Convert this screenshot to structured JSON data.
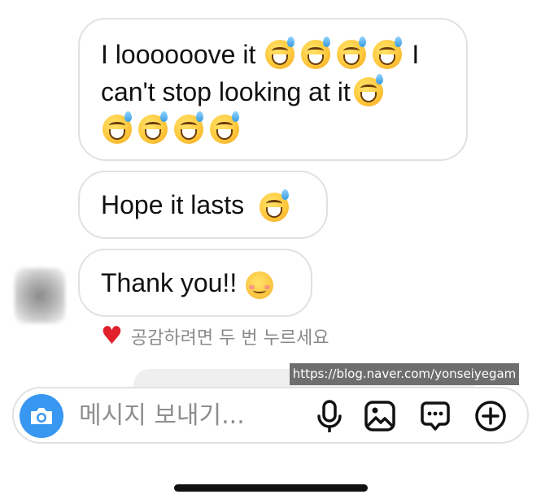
{
  "messages": [
    {
      "lines": [
        {
          "text": "I loooooove it",
          "emoji_after": 4,
          "tail": "I"
        },
        {
          "text": "can't stop looking at it",
          "emoji_after": 1
        },
        {
          "text": "",
          "emoji_after": 4
        }
      ]
    },
    {
      "text": "Hope it lasts",
      "emoji": "grinning-sweat"
    },
    {
      "text": "Thank you!!",
      "emoji": "smiling-blush"
    }
  ],
  "reaction_hint": "공감하려면 두 번 누르세요",
  "watermark": "https://blog.naver.com/yonseiyegam",
  "composer": {
    "placeholder": "메시지 보내기..."
  },
  "icons": [
    "camera-icon",
    "microphone-icon",
    "image-icon",
    "sticker-chat-icon",
    "plus-icon",
    "heart-icon"
  ],
  "colors": {
    "accent": "#3897f0",
    "heart": "#e0202b",
    "bubble_border": "#e1e1e1"
  }
}
